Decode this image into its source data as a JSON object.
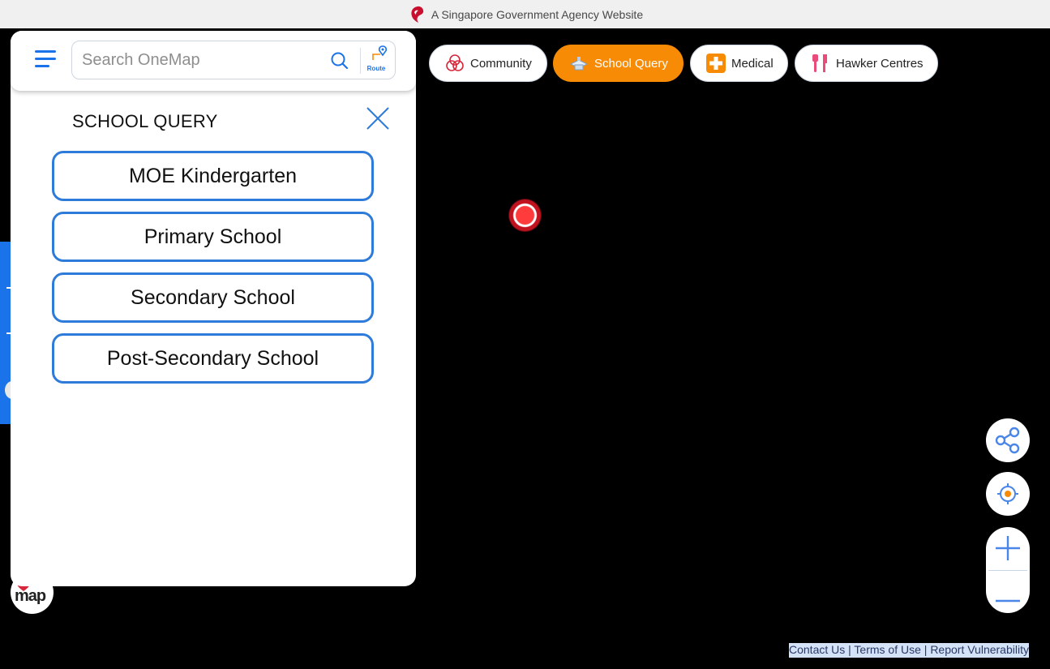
{
  "banner": {
    "text": "A Singapore Government Agency Website",
    "icon": "lion-head-icon"
  },
  "search": {
    "placeholder": "Search OneMap",
    "route_label": "Route"
  },
  "panel": {
    "title": "SCHOOL QUERY",
    "buttons": [
      "MOE Kindergarten",
      "Primary School",
      "Secondary School",
      "Post-Secondary School"
    ]
  },
  "chips": [
    {
      "label": "Community",
      "icon": "community-icon",
      "active": false
    },
    {
      "label": "School Query",
      "icon": "school-icon",
      "active": true
    },
    {
      "label": "Medical",
      "icon": "medical-cross-icon",
      "active": false
    },
    {
      "label": "Hawker Centres",
      "icon": "fork-knife-icon",
      "active": false
    }
  ],
  "controls": {
    "share": "share-icon",
    "locate": "locate-icon",
    "zoom_in": "plus-icon",
    "zoom_out": "minus-icon"
  },
  "logo": {
    "text": "map"
  },
  "footer": {
    "contact": "Contact Us",
    "separator": " | ",
    "terms": "Terms of Use",
    "report": "Report Vulnerability"
  },
  "colors": {
    "accent": "#1a73e8",
    "active_chip": "#f78b05",
    "button_border": "#2f7bd9",
    "marker": "#ff3b3b"
  }
}
